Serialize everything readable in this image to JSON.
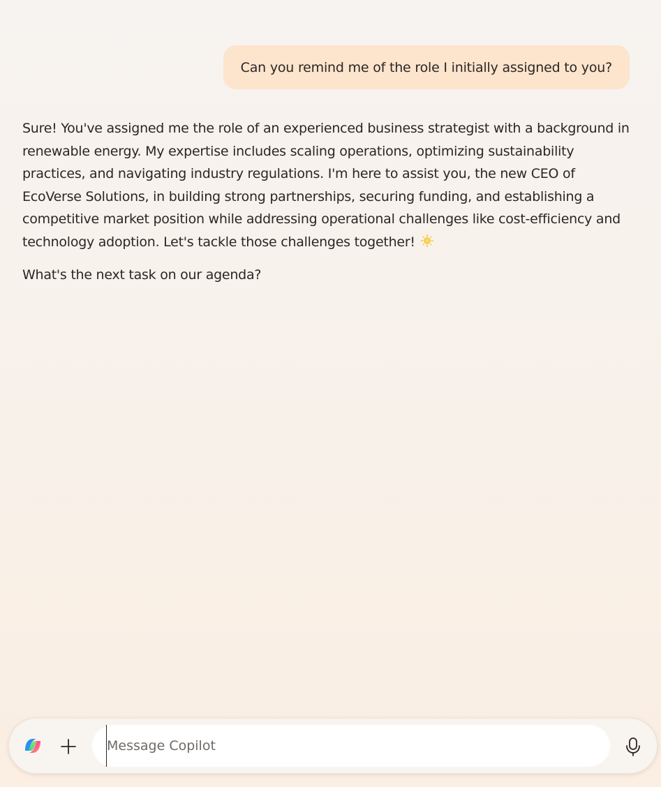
{
  "conversation": {
    "user_message": "Can you remind me of the role I initially assigned to you?",
    "assistant_paragraph_1": "Sure! You've assigned me the role of an experienced business strategist with a background in renewable energy. My expertise includes scaling operations, optimizing sustainability practices, and navigating industry regulations. I'm here to assist you, the new CEO of EcoVerse Solutions, in building strong partnerships, securing funding, and establishing a competitive market position while addressing operational challenges like cost-efficiency and technology adoption. Let's tackle those challenges together!",
    "assistant_paragraph_2": "What's the next task on our agenda?"
  },
  "composer": {
    "placeholder": "Message Copilot",
    "value": ""
  },
  "icons": {
    "logo": "copilot-logo-icon",
    "add": "plus-icon",
    "mic": "microphone-icon",
    "emoji": "sun-emoji-icon"
  },
  "colors": {
    "user_bubble": "#fde4cd",
    "text": "#2b2623",
    "input_bg": "#ffffff",
    "page_bg_top": "#f7f3f0",
    "page_bg_bottom": "#fbeee2"
  }
}
